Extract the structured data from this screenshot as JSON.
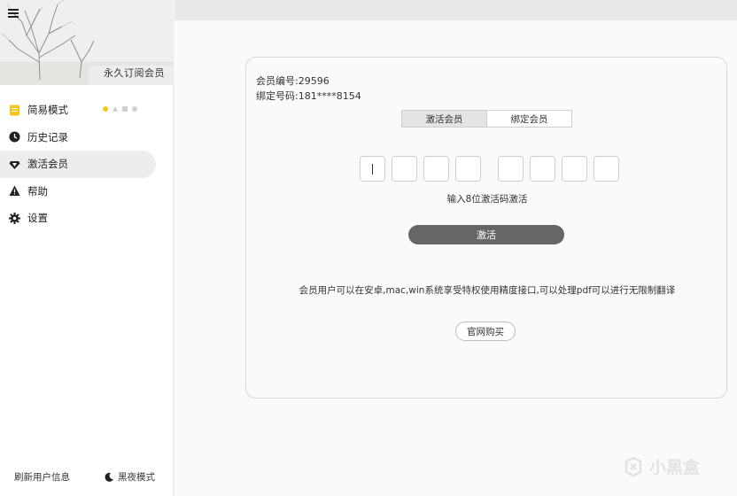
{
  "sidebar": {
    "banner_label": "永久订阅会员",
    "items": [
      {
        "label": "简易模式",
        "icon": "note-icon"
      },
      {
        "label": "历史记录",
        "icon": "clock-icon"
      },
      {
        "label": "激活会员",
        "icon": "diamond-icon"
      },
      {
        "label": "帮助",
        "icon": "warning-icon"
      },
      {
        "label": "设置",
        "icon": "gear-icon"
      }
    ],
    "active_index": 2,
    "refresh_label": "刷新用户信息",
    "night_mode_label": "黑夜模式"
  },
  "member": {
    "id_line": "会员编号:29596",
    "phone_line": "绑定号码:181****8154"
  },
  "tabs": [
    {
      "label": "激活会员",
      "active": true
    },
    {
      "label": "绑定会员",
      "active": false
    }
  ],
  "code": {
    "box_count": 8,
    "hint": "输入8位激活码激活"
  },
  "activate_label": "激活",
  "description": "会员用户可以在安卓,mac,win系统享受特权使用精度接口,可以处理pdf可以进行无限制翻译",
  "buy_label": "官网购买",
  "watermark": "小黑盒",
  "colors": {
    "accent_yellow": "#f5c518",
    "button_dark": "#666666"
  }
}
